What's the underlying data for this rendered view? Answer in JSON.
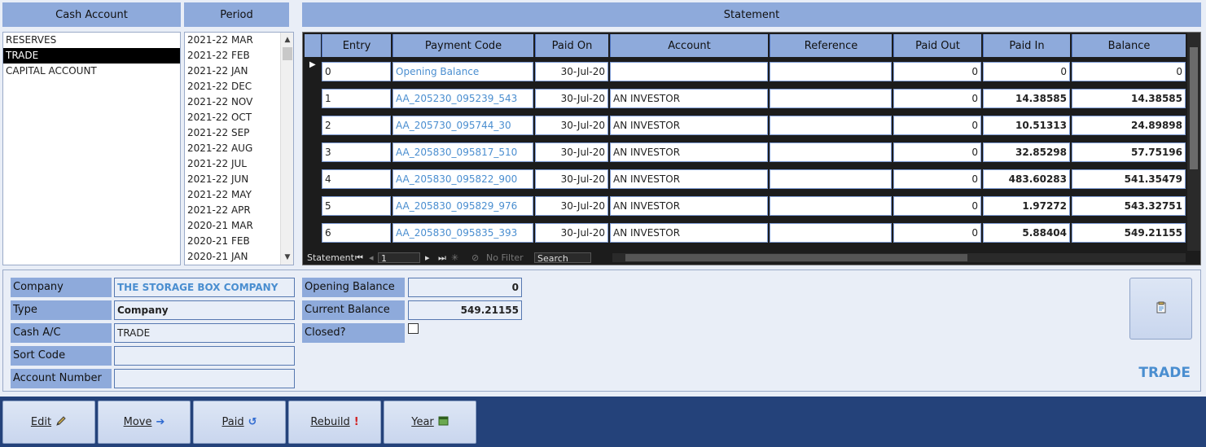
{
  "headers": {
    "cash_account": "Cash Account",
    "period": "Period",
    "statement": "Statement"
  },
  "cash_accounts": [
    {
      "label": "RESERVES",
      "selected": false
    },
    {
      "label": "TRADE",
      "selected": true
    },
    {
      "label": "CAPITAL ACCOUNT",
      "selected": false
    }
  ],
  "periods": [
    "2021-22 MAR",
    "2021-22 FEB",
    "2021-22 JAN",
    "2021-22 DEC",
    "2021-22 NOV",
    "2021-22 OCT",
    "2021-22 SEP",
    "2021-22 AUG",
    "2021-22 JUL",
    "2021-22 JUN",
    "2021-22 MAY",
    "2021-22 APR",
    "2020-21 MAR",
    "2020-21 FEB",
    "2020-21 JAN"
  ],
  "statement": {
    "columns": [
      "Entry",
      "Payment Code",
      "Paid On",
      "Account",
      "Reference",
      "Paid Out",
      "Paid In",
      "Balance"
    ],
    "rows": [
      {
        "entry": "0",
        "code": "Opening Balance",
        "paid_on": "30-Jul-20",
        "account": "",
        "reference": "",
        "paid_out": "0",
        "paid_in": "0",
        "balance": "0"
      },
      {
        "entry": "1",
        "code": "AA_205230_095239_543",
        "paid_on": "30-Jul-20",
        "account": "AN INVESTOR",
        "reference": "",
        "paid_out": "0",
        "paid_in": "14.38585",
        "balance": "14.38585"
      },
      {
        "entry": "2",
        "code": "AA_205730_095744_30",
        "paid_on": "30-Jul-20",
        "account": "AN INVESTOR",
        "reference": "",
        "paid_out": "0",
        "paid_in": "10.51313",
        "balance": "24.89898"
      },
      {
        "entry": "3",
        "code": "AA_205830_095817_510",
        "paid_on": "30-Jul-20",
        "account": "AN INVESTOR",
        "reference": "",
        "paid_out": "0",
        "paid_in": "32.85298",
        "balance": "57.75196"
      },
      {
        "entry": "4",
        "code": "AA_205830_095822_900",
        "paid_on": "30-Jul-20",
        "account": "AN INVESTOR",
        "reference": "",
        "paid_out": "0",
        "paid_in": "483.60283",
        "balance": "541.35479"
      },
      {
        "entry": "5",
        "code": "AA_205830_095829_976",
        "paid_on": "30-Jul-20",
        "account": "AN INVESTOR",
        "reference": "",
        "paid_out": "0",
        "paid_in": "1.97272",
        "balance": "543.32751"
      },
      {
        "entry": "6",
        "code": "AA_205830_095835_393",
        "paid_on": "30-Jul-20",
        "account": "AN INVESTOR",
        "reference": "",
        "paid_out": "0",
        "paid_in": "5.88404",
        "balance": "549.21155"
      }
    ],
    "nav": {
      "label": "Statement",
      "record": "1",
      "filter": "No Filter",
      "search": "Search"
    }
  },
  "details": {
    "company_label": "Company",
    "company_value": "THE STORAGE BOX COMPANY",
    "type_label": "Type",
    "type_value": "Company",
    "cash_ac_label": "Cash A/C",
    "cash_ac_value": "TRADE",
    "sort_code_label": "Sort Code",
    "sort_code_value": "",
    "account_number_label": "Account Number",
    "account_number_value": "",
    "opening_balance_label": "Opening Balance",
    "opening_balance_value": "0",
    "current_balance_label": "Current Balance",
    "current_balance_value": "549.21155",
    "closed_label": "Closed?",
    "closed_checked": false,
    "account_title": "TRADE"
  },
  "buttons": {
    "edit": "Edit",
    "move": "Move",
    "paid": "Paid",
    "rebuild": "Rebuild",
    "year": "Year"
  },
  "icons": {
    "edit": "pencil-icon",
    "move": "arrow-right-icon",
    "paid": "undo-icon",
    "rebuild": "exclamation-icon",
    "year": "calendar-icon",
    "report": "report-icon"
  },
  "colors": {
    "header_bg": "#8eaadb",
    "link": "#4a8ed0",
    "bottom_bar": "#24427a"
  }
}
